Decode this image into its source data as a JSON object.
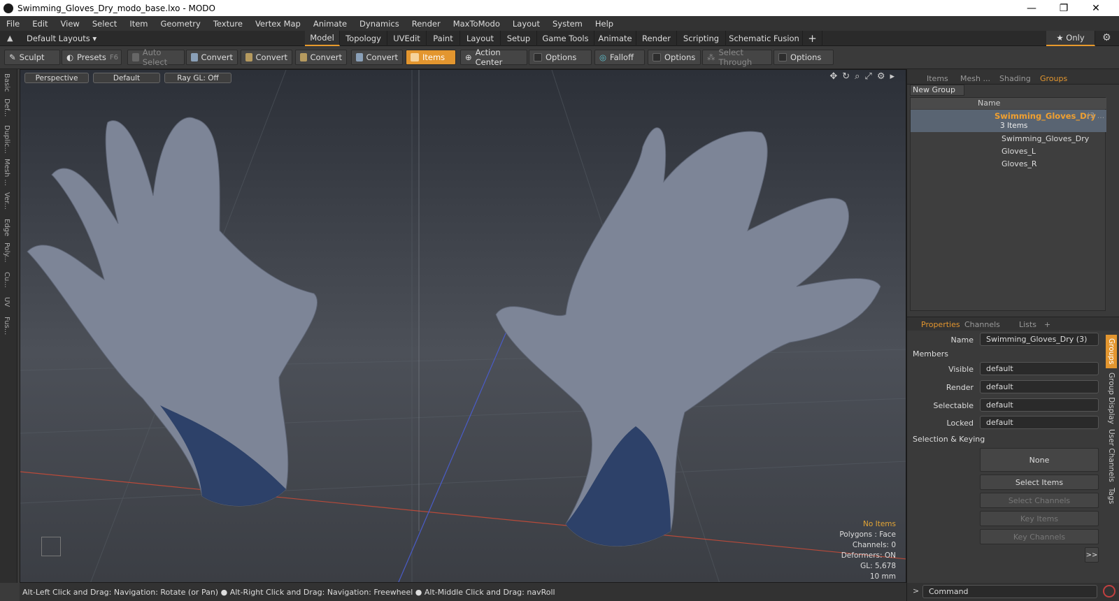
{
  "window": {
    "title": "Swimming_Gloves_Dry_modo_base.lxo - MODO",
    "minimize": "—",
    "maximize": "❐",
    "close": "✕"
  },
  "menu": [
    "File",
    "Edit",
    "View",
    "Select",
    "Item",
    "Geometry",
    "Texture",
    "Vertex Map",
    "Animate",
    "Dynamics",
    "Render",
    "MaxToModo",
    "Layout",
    "System",
    "Help"
  ],
  "layouts": {
    "label": "Default Layouts ▾",
    "tabs": [
      "Model",
      "Topology",
      "UVEdit",
      "Paint",
      "Layout",
      "Setup",
      "Game Tools",
      "Animate",
      "Render",
      "Scripting",
      "Schematic Fusion",
      "+"
    ],
    "only": "★ Only"
  },
  "toolbar": {
    "sculpt": "Sculpt",
    "presets": "Presets",
    "presets_key": "F6",
    "auto_select": "Auto Select",
    "convert1": "Convert",
    "convert2": "Convert",
    "convert3": "Convert",
    "convert4": "Convert",
    "items": "Items",
    "action_center": "Action Center",
    "options1": "Options",
    "falloff": "Falloff",
    "options2": "Options",
    "select_through": "Select Through",
    "options3": "Options"
  },
  "left_tabs": [
    "Basic",
    "Def...",
    "Duplic...",
    "Mesh ...",
    "Ver...",
    "Edge",
    "Poly...",
    "Cu...",
    "UV",
    "Fus..."
  ],
  "viewport": {
    "projection": "Perspective",
    "shading": "Default",
    "raygl": "Ray GL: Off"
  },
  "info": {
    "items": "No Items",
    "polygons": "Polygons : Face",
    "channels": "Channels: 0",
    "deformers": "Deformers: ON",
    "gl": "GL: 5,678",
    "scale": "10 mm"
  },
  "status": "Alt-Left Click and Drag: Navigation: Rotate (or Pan) ● Alt-Right Click and Drag: Navigation: Freewheel ● Alt-Middle Click and Drag: navRoll",
  "groups_panel": {
    "tabs": [
      "Items",
      "Mesh ...",
      "Shading",
      "Groups"
    ],
    "new_group": "New Group",
    "col_name": "Name",
    "group_name": "Swimming_Gloves_Dry",
    "group_count": "(3 ...",
    "group_sub": "3 Items",
    "children": [
      "Swimming_Gloves_Dry",
      "Gloves_L",
      "Gloves_R"
    ]
  },
  "properties": {
    "tabs": [
      "Properties",
      "Channels",
      "Lists",
      "+"
    ],
    "name_label": "Name",
    "name_value": "Swimming_Gloves_Dry (3)",
    "members": "Members",
    "visible_label": "Visible",
    "render_label": "Render",
    "selectable_label": "Selectable",
    "locked_label": "Locked",
    "default": "default",
    "sel_keying": "Selection & Keying",
    "none": "None",
    "select_items": "Select Items",
    "select_channels": "Select Channels",
    "key_items": "Key Items",
    "key_channels": "Key Channels",
    "more": ">>"
  },
  "side_tabs": [
    "Groups",
    "Group Display",
    "User Channels",
    "Tags"
  ],
  "command": "Command"
}
